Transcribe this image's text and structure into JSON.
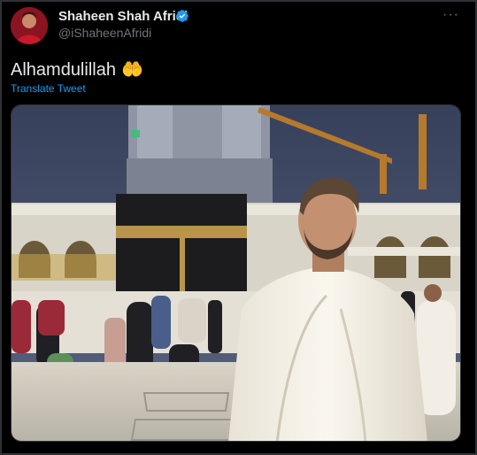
{
  "author": {
    "name": "Shaheen Shah Afridi",
    "handle": "@iShaheenAfridi",
    "verified": true
  },
  "tweet": {
    "text": "Alhamdulillah",
    "emoji": "🤲",
    "translate_label": "Translate Tweet",
    "more_label": "···"
  },
  "colors": {
    "background": "#000000",
    "link": "#1d9bf0",
    "verified_badge": "#1d9bf0",
    "muted": "#71767b"
  },
  "icons": {
    "verified": "verified-badge-icon",
    "more": "more-options-icon"
  }
}
